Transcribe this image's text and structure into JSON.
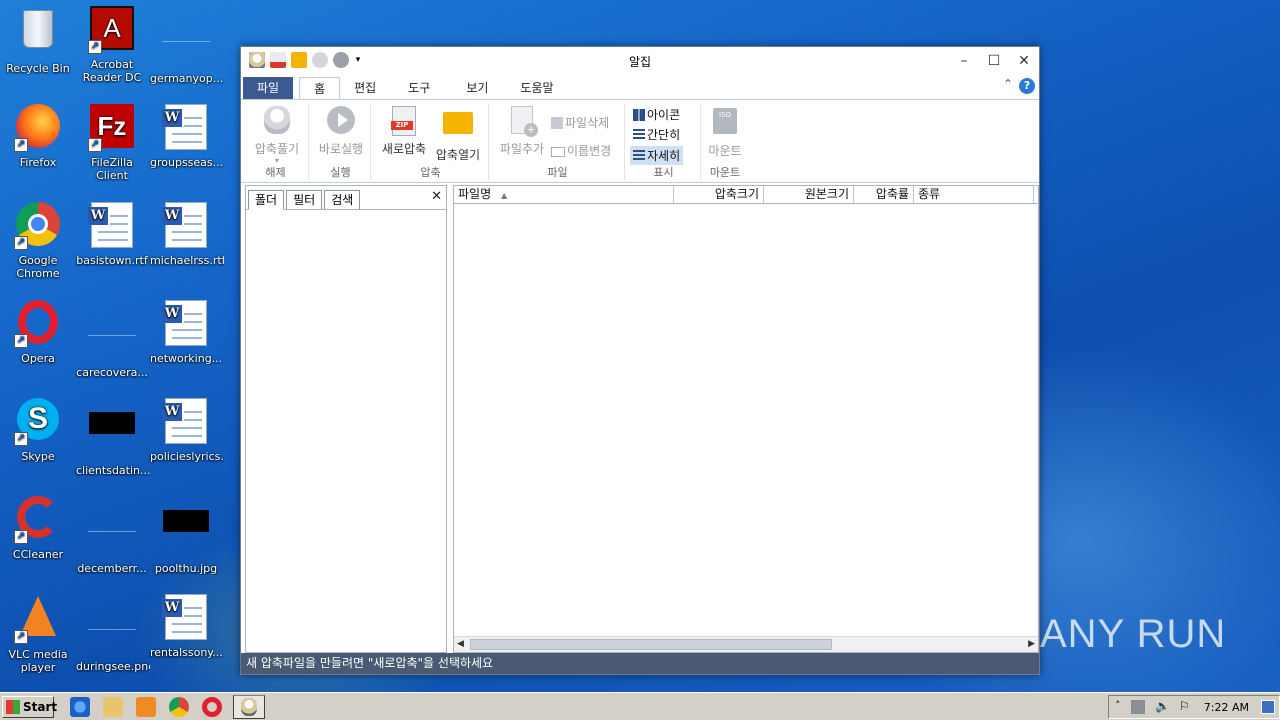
{
  "desktop": {
    "icons": [
      {
        "label": "Recycle Bin"
      },
      {
        "label": "Acrobat\nReader DC"
      },
      {
        "label": "germanyop..."
      },
      {
        "label": "Firefox"
      },
      {
        "label": "FileZilla Client"
      },
      {
        "label": "groupsseas..."
      },
      {
        "label": "Google\nChrome"
      },
      {
        "label": "basistown.rtf"
      },
      {
        "label": "michaelrss.rtf"
      },
      {
        "label": "Opera"
      },
      {
        "label": "carecovera..."
      },
      {
        "label": "networking..."
      },
      {
        "label": "Skype"
      },
      {
        "label": "clientsdatin..."
      },
      {
        "label": "policieslyrics..."
      },
      {
        "label": "CCleaner"
      },
      {
        "label": "decemberr..."
      },
      {
        "label": "poolthu.jpg"
      },
      {
        "label": "VLC media\nplayer"
      },
      {
        "label": "duringsee.png"
      },
      {
        "label": "rentalssony..."
      }
    ],
    "watermark": "ANY RUN"
  },
  "window": {
    "title": "알집",
    "tabs": [
      "파일",
      "홈",
      "편집",
      "도구",
      "보기",
      "도움말"
    ],
    "active_tab": "홈",
    "help_label": "?",
    "ribbon": {
      "extract": {
        "button": "압축풀기",
        "group": "해제"
      },
      "run": {
        "button": "바로실행",
        "group": "실행"
      },
      "compress": {
        "new_button": "새로압축",
        "open_button": "압축열기",
        "group": "압축"
      },
      "file": {
        "add_button": "파일추가",
        "delete_button": "파일삭제",
        "rename_button": "이름변경",
        "group": "파일"
      },
      "view": {
        "icon_button": "아이콘",
        "simple_button": "간단히",
        "detail_button": "자세히",
        "group": "표시"
      },
      "mount": {
        "button": "마운트",
        "group": "마운트",
        "badge": "ISO"
      }
    },
    "left_tabs": [
      "폴더",
      "필터",
      "검색"
    ],
    "close_glyph": "✕",
    "columns": [
      "파일명",
      "압축크기",
      "원본크기",
      "압축률",
      "종류"
    ],
    "status": "새 압축파일을 만들려면 \"새로압축\"을 선택하세요"
  },
  "taskbar": {
    "start_label": "Start",
    "clock": "7:22 AM"
  }
}
